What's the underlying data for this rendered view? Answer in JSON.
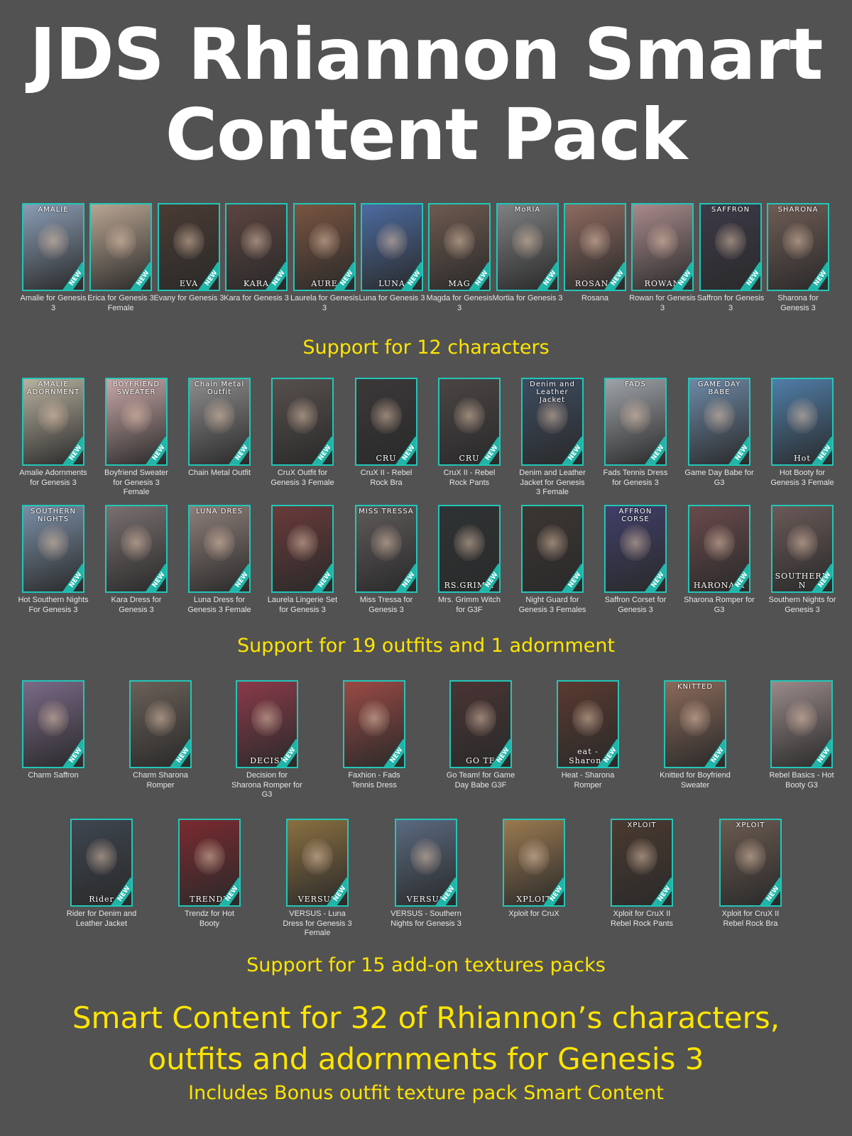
{
  "title": {
    "line1": "JDS Rhiannon Smart",
    "line2": "Content Pack"
  },
  "colors": {
    "background": "#525252",
    "title": "#ffffff",
    "accent": "#ffe500",
    "thumb_border": "#22c6b8"
  },
  "badge_text": "NEW",
  "characters": [
    {
      "caption": "Amalie for Genesis 3",
      "top": "AMALIE",
      "bottom": "",
      "bg": "#8a9db4"
    },
    {
      "caption": "Erica for Genesis 3 Female",
      "top": "",
      "bottom": "",
      "bg": "#b9a592"
    },
    {
      "caption": "Evany for Genesis 3",
      "top": "",
      "bottom": "EVA",
      "bg": "#4a3b33"
    },
    {
      "caption": "Kara for Genesis 3",
      "top": "",
      "bottom": "KARA",
      "bg": "#5c4440"
    },
    {
      "caption": "Laurela for Genesis 3",
      "top": "",
      "bottom": "AURE",
      "bg": "#7a5440"
    },
    {
      "caption": "Luna for Genesis 3",
      "top": "",
      "bottom": "LUNA",
      "bg": "#4b6ba0"
    },
    {
      "caption": "Magda for Genesis 3",
      "top": "",
      "bottom": "MAG",
      "bg": "#6d5a4f"
    },
    {
      "caption": "Mortia for Genesis 3",
      "top": "MoRIA",
      "bottom": "",
      "bg": "#7e8082"
    },
    {
      "caption": "Rosana",
      "top": "",
      "bottom": "ROSANA",
      "bg": "#8d6a60"
    },
    {
      "caption": "Rowan for Genesis 3",
      "top": "",
      "bottom": "ROWAN",
      "bg": "#a98a8c"
    },
    {
      "caption": "Saffron for Genesis 3",
      "top": "SAFFRON",
      "bottom": "",
      "bg": "#3c3a48"
    },
    {
      "caption": "Sharona for Genesis 3",
      "top": "SHARONA",
      "bottom": "",
      "bg": "#6f5c55"
    }
  ],
  "section1": "Support for 12 characters",
  "outfits_row1": [
    {
      "caption": "Amalie Adornments for Genesis 3",
      "top": "AMALIE ADORNMENT",
      "bottom": "",
      "bg": "#b8b2a0"
    },
    {
      "caption": "Boyfriend Sweater for Genesis 3 Female",
      "top": "BOYFRIEND SWEATER",
      "bottom": "",
      "bg": "#c9a8a8"
    },
    {
      "caption": "Chain Metal Outfit",
      "top": "Chain Metal Outfit",
      "bottom": "",
      "bg": "#8d8d8d"
    },
    {
      "caption": "CruX Outfit for Genesis 3 Female",
      "top": "",
      "bottom": "",
      "bg": "#57504d"
    },
    {
      "caption": "CruX II - Rebel Rock Bra",
      "top": "",
      "bottom": "CRU",
      "bg": "#3b3838"
    },
    {
      "caption": "CruX II - Rebel Rock Pants",
      "top": "",
      "bottom": "CRU",
      "bg": "#4a4544"
    },
    {
      "caption": "Denim and Leather Jacket for Genesis 3 Female",
      "top": "Denim and Leather Jacket",
      "bottom": "",
      "bg": "#3d4c60"
    },
    {
      "caption": "Fads Tennis Dress for Genesis 3",
      "top": "FADS",
      "bottom": "",
      "bg": "#9ea3a8"
    },
    {
      "caption": "Game Day Babe for G3",
      "top": "GAME DAY BABE",
      "bottom": "",
      "bg": "#6d89a6"
    },
    {
      "caption": "Hot Booty for Genesis 3 Female",
      "top": "",
      "bottom": "Hot",
      "bg": "#4f7ea8"
    }
  ],
  "outfits_row2": [
    {
      "caption": "Hot Southern Nights For Genesis 3",
      "top": "SOUTHERN NIGHTS",
      "bottom": "",
      "bg": "#7b8fa6"
    },
    {
      "caption": "Kara Dress for Genesis 3",
      "top": "",
      "bottom": "",
      "bg": "#7a7070"
    },
    {
      "caption": "Luna Dress for Genesis 3 Female",
      "top": "LUNA DRES",
      "bottom": "",
      "bg": "#8e7f7a"
    },
    {
      "caption": "Laurela Lingerie Set for Genesis 3",
      "top": "",
      "bottom": "",
      "bg": "#6a3a3a"
    },
    {
      "caption": "Miss Tressa for Genesis 3",
      "top": "MISS TRESSA",
      "bottom": "",
      "bg": "#5f5a5a"
    },
    {
      "caption": "Mrs. Grimm Witch for G3F",
      "top": "",
      "bottom": "RS.GRIMM",
      "bg": "#2f3335"
    },
    {
      "caption": "Night Guard for Genesis 3 Females",
      "top": "",
      "bottom": "",
      "bg": "#3c3632"
    },
    {
      "caption": "Saffron Corset for Genesis 3",
      "top": "AFFRON CORSE",
      "bottom": "",
      "bg": "#3f3f6a"
    },
    {
      "caption": "Sharona Romper for G3",
      "top": "",
      "bottom": "HARONA R",
      "bg": "#6a4a4c"
    },
    {
      "caption": "Southern Nights for Genesis 3",
      "top": "",
      "bottom": "SOUTHERN N",
      "bg": "#6a5a58"
    }
  ],
  "section2": "Support for 19 outfits and 1 adornment",
  "textures_row1": [
    {
      "caption": "Charm Saffron",
      "top": "",
      "bottom": "",
      "bg": "#7a6a88"
    },
    {
      "caption": "Charm Sharona Romper",
      "top": "",
      "bottom": "",
      "bg": "#6a6058"
    },
    {
      "caption": "Decision for Sharona Romper for G3",
      "top": "",
      "bottom": "DECISI",
      "bg": "#8a3a4a"
    },
    {
      "caption": "Faxhion - Fads Tennis Dress",
      "top": "",
      "bottom": "",
      "bg": "#9a4a44"
    },
    {
      "caption": "Go Team! for Game Day Babe G3F",
      "top": "",
      "bottom": "GO TE",
      "bg": "#4a3434"
    },
    {
      "caption": "Heat - Sharona Romper",
      "top": "",
      "bottom": "eat - Sharona",
      "bg": "#5a3a30"
    },
    {
      "caption": "Knitted for Boyfriend Sweater",
      "top": "KNITTED",
      "bottom": "",
      "bg": "#8a6a5a"
    },
    {
      "caption": "Rebel Basics - Hot Booty G3",
      "top": "",
      "bottom": "",
      "bg": "#9a8a8a"
    }
  ],
  "textures_row2": [
    {
      "caption": "Rider for Denim and Leather Jacket",
      "top": "",
      "bottom": "Rider",
      "bg": "#3e4650"
    },
    {
      "caption": "Trendz for Hot Booty",
      "top": "",
      "bottom": "TRENDZ",
      "bg": "#7a2a30"
    },
    {
      "caption": "VERSUS - Luna Dress for Genesis 3 Female",
      "top": "",
      "bottom": "VERSUS",
      "bg": "#8a7040"
    },
    {
      "caption": "VERSUS - Southern Nights for Genesis 3",
      "top": "",
      "bottom": "VERSUS",
      "bg": "#5a6a80"
    },
    {
      "caption": "Xploit for CruX",
      "top": "",
      "bottom": "XPLOIT",
      "bg": "#9a7a50"
    },
    {
      "caption": "Xploit for CruX II Rebel Rock Pants",
      "top": "XPLOIT",
      "bottom": "",
      "bg": "#4a3a30"
    },
    {
      "caption": "Xploit for CruX II Rebel Rock Bra",
      "top": "XPLOIT",
      "bottom": "",
      "bg": "#6a5a50"
    }
  ],
  "section3": "Support for 15 add-on textures packs",
  "footer": {
    "line1": "Smart Content for 32 of Rhiannon’s characters,",
    "line2": "outfits and adornments for Genesis 3",
    "line3": "Includes Bonus outfit texture pack Smart Content"
  }
}
